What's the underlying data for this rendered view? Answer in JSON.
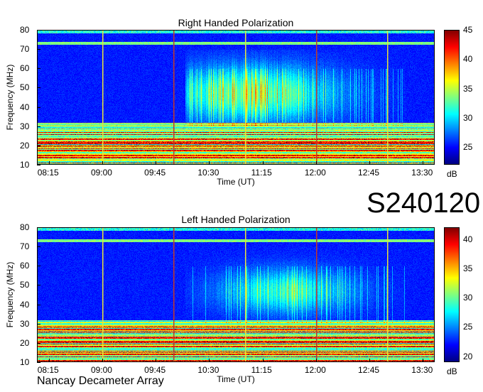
{
  "footer_label": "Nancay Decameter Array",
  "event_code": "S240120",
  "chart_data": [
    {
      "type": "heatmap",
      "title": "Right Handed Polarization",
      "xlabel": "Time (UT)",
      "ylabel": "Frequency (MHz)",
      "x_ticks": [
        "08:15",
        "09:00",
        "09:45",
        "10:30",
        "11:15",
        "12:00",
        "12:45",
        "13:30"
      ],
      "y_ticks": [
        10,
        20,
        30,
        40,
        50,
        60,
        70,
        80
      ],
      "ylim": [
        10,
        80
      ],
      "colorbar": {
        "label": "dB",
        "ticks": [
          25,
          30,
          35,
          40,
          45
        ],
        "range": [
          22,
          45
        ]
      },
      "colormap": "jet",
      "burst_times": [
        "09:00",
        "10:00",
        "11:00",
        "12:00",
        "13:00"
      ]
    },
    {
      "type": "heatmap",
      "title": "Left Handed Polarization",
      "xlabel": "Time (UT)",
      "ylabel": "Frequency (MHz)",
      "x_ticks": [
        "08:15",
        "09:00",
        "09:45",
        "10:30",
        "11:15",
        "12:00",
        "12:45",
        "13:30"
      ],
      "y_ticks": [
        10,
        20,
        30,
        40,
        50,
        60,
        70,
        80
      ],
      "ylim": [
        10,
        80
      ],
      "colorbar": {
        "label": "dB",
        "ticks": [
          20,
          25,
          30,
          35,
          40
        ],
        "range": [
          19,
          42
        ]
      },
      "colormap": "jet",
      "burst_times": [
        "09:00",
        "10:00",
        "11:00",
        "12:00",
        "13:00"
      ]
    }
  ]
}
